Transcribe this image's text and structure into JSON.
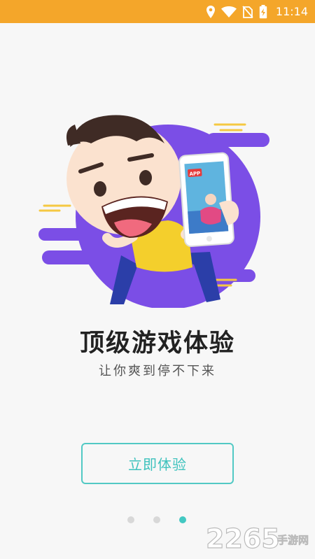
{
  "status_bar": {
    "time": "11:14",
    "icons": [
      "location-icon",
      "wifi-icon",
      "no-sim-icon",
      "battery-charging-icon"
    ],
    "background": "#f4a62a"
  },
  "onboarding": {
    "title": "顶级游戏体验",
    "subtitle": "让你爽到停不下来",
    "cta_label": "立即体验",
    "phone_badge": "APP",
    "page_count": 3,
    "active_page": 3,
    "accent_color": "#43c8c2",
    "blob_color": "#7b4ee6"
  },
  "watermark": {
    "number": "2265",
    "text": "手游网"
  }
}
